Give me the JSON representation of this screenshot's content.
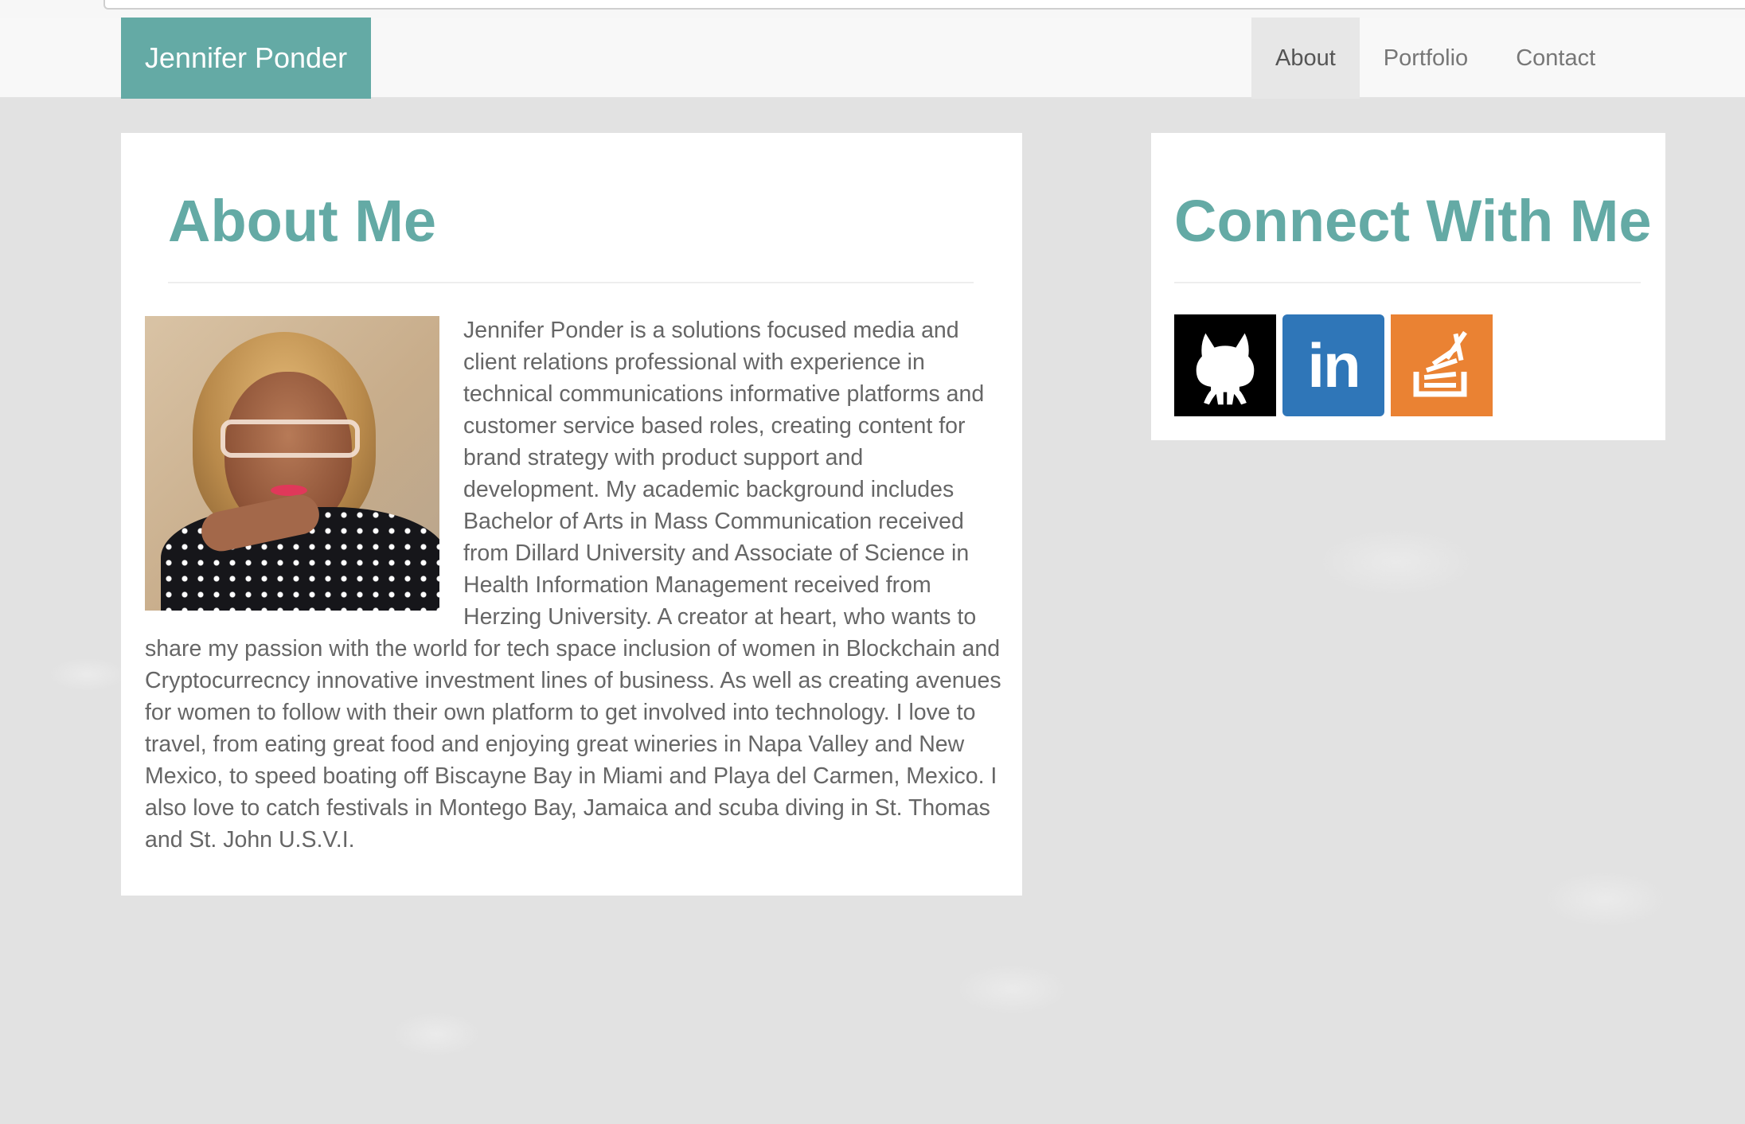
{
  "navbar": {
    "brand": "Jennifer Ponder",
    "items": [
      {
        "label": "About",
        "active": true
      },
      {
        "label": "Portfolio",
        "active": false
      },
      {
        "label": "Contact",
        "active": false
      }
    ]
  },
  "about": {
    "title": "About Me",
    "photo_alt": "Profile photo of Jennifer Ponder",
    "bio": "Jennifer Ponder is a solutions focused media and client relations professional with experience in technical communications informative platforms and customer service based roles, creating content for brand strategy with product support and development. My academic background includes Bachelor of Arts in Mass Communication received from Dillard University and Associate of Science in Health Information Management received from Herzing University. A creator at heart, who wants to share my passion with the world for tech space inclusion of women in Blockchain and Cryptocurrecncy innovative investment lines of business. As well as creating avenues for women to follow with their own platform to get involved into technology. I love to travel, from eating great food and enjoying great wineries in Napa Valley and New Mexico, to speed boating off Biscayne Bay in Miami and Playa del Carmen, Mexico. I also love to catch festivals in Montego Bay, Jamaica and scuba diving in St. Thomas and St. John U.S.V.I."
  },
  "connect": {
    "title": "Connect With Me",
    "links": [
      {
        "name": "github",
        "icon": "github-octocat-icon",
        "color": "#000000"
      },
      {
        "name": "linkedin",
        "icon": "linkedin-icon",
        "label": "in",
        "color": "#2f76b8"
      },
      {
        "name": "stackoverflow",
        "icon": "stackoverflow-icon",
        "color": "#ea8233"
      }
    ]
  },
  "theme": {
    "accent": "#64aaa5",
    "text": "#666666",
    "background": "#e2e2e2"
  }
}
